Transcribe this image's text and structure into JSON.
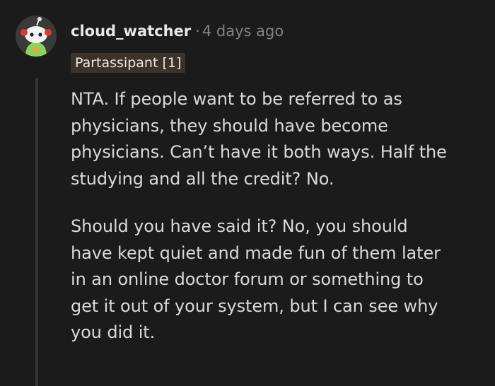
{
  "comment": {
    "username": "cloud_watcher",
    "separator": "·",
    "timestamp": "4 days ago",
    "flair": "Partassipant [1]",
    "avatar_icon": "snoo-avatar-icon",
    "paragraphs": [
      {
        "lines": [
          "NTA. If people want to be referred to as",
          "physicians, they should have become",
          "physicians. Can’t have it both ways. Half the",
          "studying and all the credit? No."
        ]
      },
      {
        "lines": [
          "Should you have said it? No, you should",
          "have kept quiet and made fun of them later",
          "in an online doctor forum or something to",
          "get it out of your system, but I can see why",
          "you did it."
        ]
      }
    ]
  },
  "colors": {
    "background": "#1b1b1b",
    "text": "#d7dadc",
    "meta": "#818384",
    "flair_bg": "#3c3228",
    "thread_line": "#343536"
  }
}
